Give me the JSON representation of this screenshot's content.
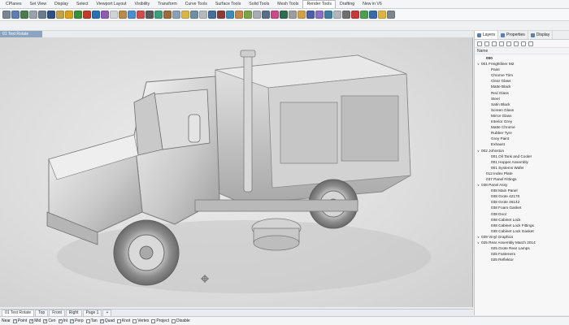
{
  "menu": {
    "tabs": [
      "CPlanes",
      "Set View",
      "Display",
      "Select",
      "Viewport Layout",
      "Visibility",
      "Transform",
      "Curve Tools",
      "Surface Tools",
      "Solid Tools",
      "Mesh Tools",
      "Render Tools",
      "Drafting",
      "New in V6"
    ],
    "active_index": 11
  },
  "toolbar": {
    "icon_colors": [
      "#7a8691",
      "#5a7fb0",
      "#4a7c4e",
      "#9aa2ab",
      "#6b7c8e",
      "#2f4f7f",
      "#c2a14a",
      "#d6a21c",
      "#3a8f3a",
      "#c23a2a",
      "#2a6fb5",
      "#8f5ab0",
      "#cfd3d8",
      "#b88b4a",
      "#4b8fd0",
      "#d34b4b",
      "#5b5b5b",
      "#3e9e7a",
      "#9c6b3a",
      "#8aa0b8",
      "#d8b648",
      "#6f8fa8",
      "#b5b9bf",
      "#476c9a",
      "#8c3a3a",
      "#3b8cb8",
      "#c5864b",
      "#7aa54b",
      "#a8adb3",
      "#5a6f86",
      "#c94b8a",
      "#2f6b4f",
      "#9d9d9d",
      "#d1a14a",
      "#4a5fa8",
      "#8a6fc2",
      "#3f7f9f",
      "#b2b6bb",
      "#6f6f6f",
      "#c73a3a",
      "#4f9d4f",
      "#3a6ba8",
      "#e0b240",
      "#7d8590"
    ]
  },
  "viewport": {
    "tab_label": "01 Test Rotate"
  },
  "panel": {
    "tabs": [
      "Layers",
      "Properties",
      "Display"
    ],
    "active_index": 0,
    "header": "Name",
    "layers": [
      {
        "label": "000",
        "indent": 1,
        "caret": false,
        "bold": true
      },
      {
        "label": "001 Freightliner M2",
        "indent": 0,
        "caret": true
      },
      {
        "label": "Paint",
        "indent": 2,
        "caret": false
      },
      {
        "label": "Chrome Trim",
        "indent": 2,
        "caret": false
      },
      {
        "label": "Clear Glass",
        "indent": 2,
        "caret": false
      },
      {
        "label": "Matte Black",
        "indent": 2,
        "caret": false
      },
      {
        "label": "Red Glass",
        "indent": 2,
        "caret": false
      },
      {
        "label": "Steel",
        "indent": 2,
        "caret": false
      },
      {
        "label": "Satin Black",
        "indent": 2,
        "caret": false
      },
      {
        "label": "Screen Glass",
        "indent": 2,
        "caret": false
      },
      {
        "label": "Mirror Glass",
        "indent": 2,
        "caret": false
      },
      {
        "label": "Interior Grey",
        "indent": 2,
        "caret": false
      },
      {
        "label": "Matte Chrome",
        "indent": 2,
        "caret": false
      },
      {
        "label": "Rubber Tyre",
        "indent": 2,
        "caret": false
      },
      {
        "label": "Grey Paint",
        "indent": 2,
        "caret": false
      },
      {
        "label": "Exhaust",
        "indent": 2,
        "caret": false
      },
      {
        "label": "002 Johnston",
        "indent": 0,
        "caret": true
      },
      {
        "label": "001 Oil Tank and Cooler",
        "indent": 2,
        "caret": false
      },
      {
        "label": "001 Hopper Assembly",
        "indent": 2,
        "caret": false
      },
      {
        "label": "001 Systems Wafer",
        "indent": 2,
        "caret": false
      },
      {
        "label": "012 Index Plate",
        "indent": 1,
        "caret": false
      },
      {
        "label": "037 Panel Fittings",
        "indent": 1,
        "caret": false
      },
      {
        "label": "038 Panel Assy",
        "indent": 0,
        "caret": true
      },
      {
        "label": "038 Main Panel",
        "indent": 2,
        "caret": false
      },
      {
        "label": "038 Grote 42170",
        "indent": 2,
        "caret": false
      },
      {
        "label": "038 Grote 46142",
        "indent": 2,
        "caret": false
      },
      {
        "label": "038 Foam Gasket",
        "indent": 2,
        "caret": false
      },
      {
        "label": "038 Door",
        "indent": 2,
        "caret": false
      },
      {
        "label": "038 Cabinet Lock",
        "indent": 2,
        "caret": false
      },
      {
        "label": "038 Cabinet Lock Fittings",
        "indent": 2,
        "caret": false
      },
      {
        "label": "038 Cabinet Lock Gasket",
        "indent": 2,
        "caret": false
      },
      {
        "label": "039 Vinyl Graphics",
        "indent": 0,
        "caret": true
      },
      {
        "label": "025 Rear Assembly March 2014",
        "indent": 0,
        "caret": true
      },
      {
        "label": "025 Grote Rear Lamps",
        "indent": 2,
        "caret": false
      },
      {
        "label": "025 Fasteners",
        "indent": 2,
        "caret": false
      },
      {
        "label": "025 Reflektor",
        "indent": 2,
        "caret": false
      }
    ]
  },
  "viewtabs": {
    "tabs": [
      "01 Test Rotate",
      "Top",
      "Front",
      "Right",
      "Page 1"
    ],
    "add_label": "+",
    "active_index": 0
  },
  "statusbar": {
    "snaps": [
      {
        "label": "Near",
        "on": false,
        "box": false
      },
      {
        "label": "Point",
        "on": true
      },
      {
        "label": "Mid",
        "on": true
      },
      {
        "label": "Cen",
        "on": true
      },
      {
        "label": "Int",
        "on": true
      },
      {
        "label": "Perp",
        "on": true
      },
      {
        "label": "Tan",
        "on": false
      },
      {
        "label": "Quad",
        "on": true
      },
      {
        "label": "Knot",
        "on": false
      },
      {
        "label": "Vertex",
        "on": false
      },
      {
        "label": "Project",
        "on": false
      },
      {
        "label": "Disable",
        "on": false
      }
    ]
  }
}
